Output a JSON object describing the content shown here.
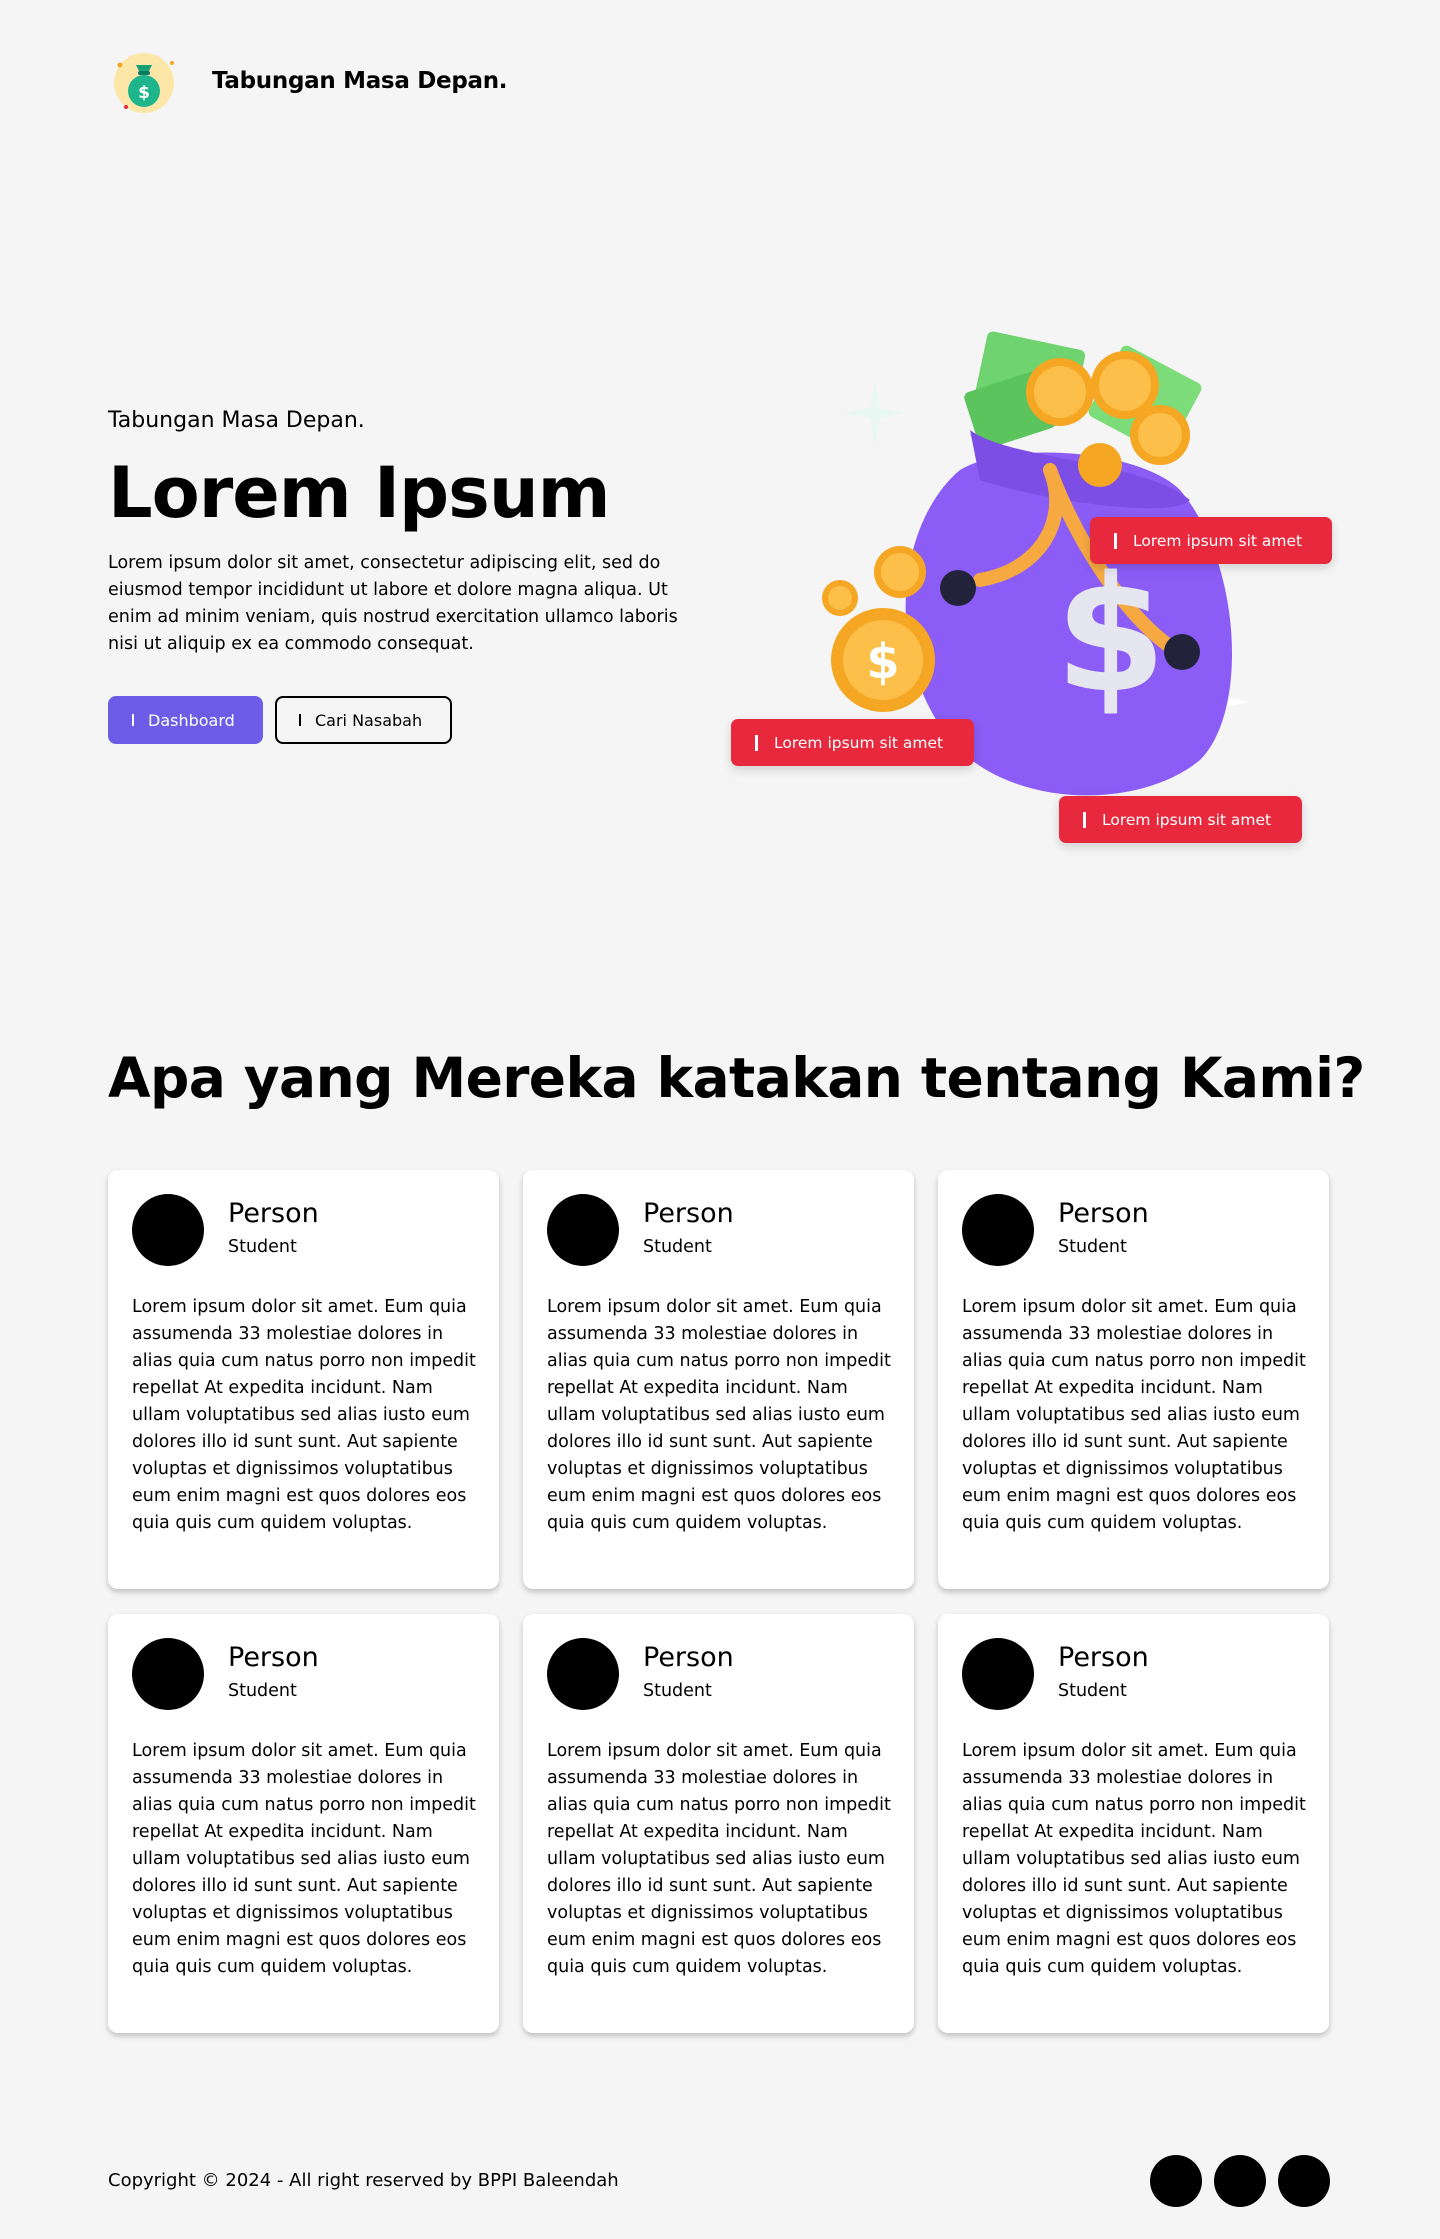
{
  "brand": {
    "name": "Tabungan Masa Depan."
  },
  "hero": {
    "kicker": "Tabungan Masa Depan.",
    "title": "Lorem Ipsum",
    "description": "Lorem ipsum dolor sit amet, consectetur adipiscing elit, sed do eiusmod tempor incididunt ut labore et dolore magna aliqua. Ut enim ad minim veniam, quis nostrud exercitation ullamco laboris nisi ut aliquip ex ea commodo consequat.",
    "primary_button": "Dashboard",
    "secondary_button": "Cari Nasabah",
    "tags": [
      "Lorem ipsum sit amet",
      "Lorem ipsum sit amet",
      "Lorem ipsum sit amet"
    ],
    "illustration_icon": "money-bag-icon"
  },
  "testimonials": {
    "title": "Apa yang Mereka katakan tentang Kami?",
    "items": [
      {
        "name": "Person",
        "role": "Student",
        "text": "Lorem ipsum dolor sit amet. Eum quia assumenda 33 molestiae dolores in alias quia cum natus porro non impedit repellat At expedita incidunt. Nam ullam voluptatibus sed alias iusto eum dolores illo id sunt sunt. Aut sapiente voluptas et dignissimos voluptatibus eum enim magni est quos dolores eos quia quis cum quidem voluptas."
      },
      {
        "name": "Person",
        "role": "Student",
        "text": "Lorem ipsum dolor sit amet. Eum quia assumenda 33 molestiae dolores in alias quia cum natus porro non impedit repellat At expedita incidunt. Nam ullam voluptatibus sed alias iusto eum dolores illo id sunt sunt. Aut sapiente voluptas et dignissimos voluptatibus eum enim magni est quos dolores eos quia quis cum quidem voluptas."
      },
      {
        "name": "Person",
        "role": "Student",
        "text": "Lorem ipsum dolor sit amet. Eum quia assumenda 33 molestiae dolores in alias quia cum natus porro non impedit repellat At expedita incidunt. Nam ullam voluptatibus sed alias iusto eum dolores illo id sunt sunt. Aut sapiente voluptas et dignissimos voluptatibus eum enim magni est quos dolores eos quia quis cum quidem voluptas."
      },
      {
        "name": "Person",
        "role": "Student",
        "text": "Lorem ipsum dolor sit amet. Eum quia assumenda 33 molestiae dolores in alias quia cum natus porro non impedit repellat At expedita incidunt. Nam ullam voluptatibus sed alias iusto eum dolores illo id sunt sunt. Aut sapiente voluptas et dignissimos voluptatibus eum enim magni est quos dolores eos quia quis cum quidem voluptas."
      },
      {
        "name": "Person",
        "role": "Student",
        "text": "Lorem ipsum dolor sit amet. Eum quia assumenda 33 molestiae dolores in alias quia cum natus porro non impedit repellat At expedita incidunt. Nam ullam voluptatibus sed alias iusto eum dolores illo id sunt sunt. Aut sapiente voluptas et dignissimos voluptatibus eum enim magni est quos dolores eos quia quis cum quidem voluptas."
      },
      {
        "name": "Person",
        "role": "Student",
        "text": "Lorem ipsum dolor sit amet. Eum quia assumenda 33 molestiae dolores in alias quia cum natus porro non impedit repellat At expedita incidunt. Nam ullam voluptatibus sed alias iusto eum dolores illo id sunt sunt. Aut sapiente voluptas et dignissimos voluptatibus eum enim magni est quos dolores eos quia quis cum quidem voluptas."
      }
    ]
  },
  "footer": {
    "copyright": "Copyright © 2024 - All right reserved by BPPI Baleendah",
    "social_icons": [
      "social-icon",
      "social-icon",
      "social-icon"
    ]
  },
  "colors": {
    "background": "#f5f5f5",
    "primary": "#6c5ce7",
    "tag": "#e8283d",
    "card": "#ffffff"
  }
}
